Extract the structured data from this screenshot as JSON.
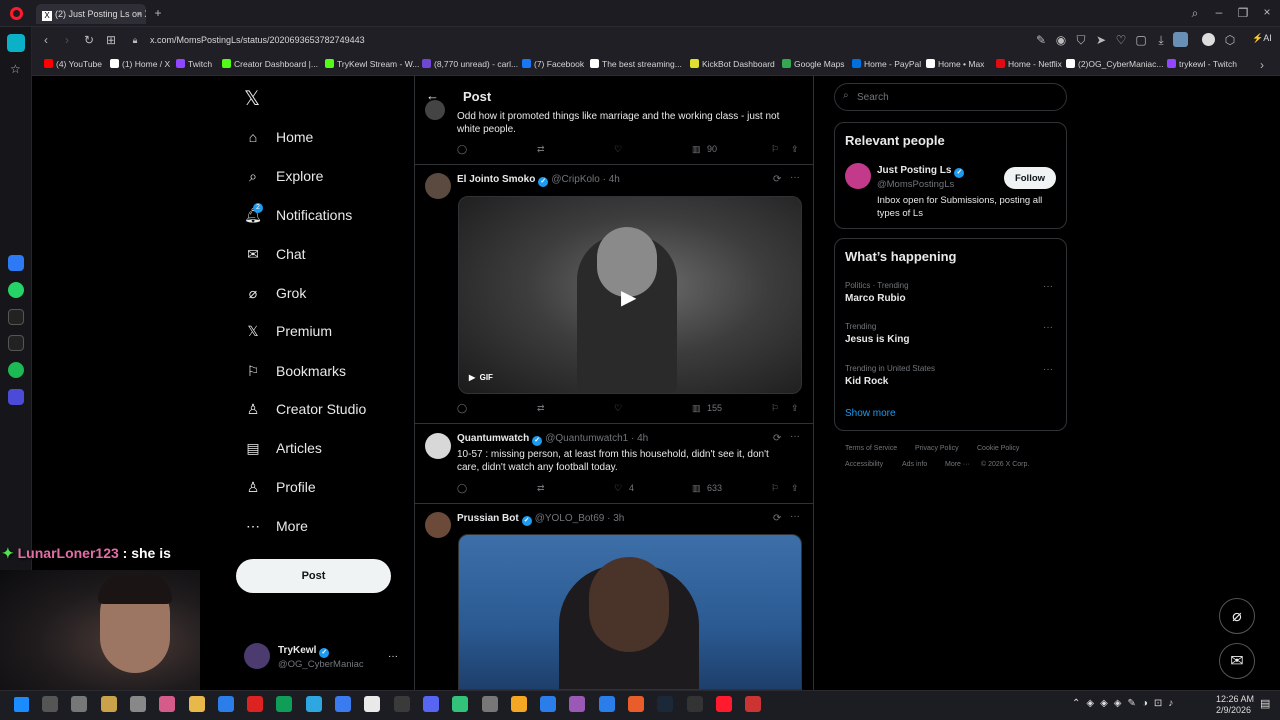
{
  "browser": {
    "tab_title": "(2) Just Posting Ls on X: \"",
    "url": "x.com/MomsPostingLs/status/2020693653782749443",
    "bookmarks": [
      {
        "label": "(4) YouTube",
        "color": "#ff0000"
      },
      {
        "label": "(1) Home / X",
        "color": "#ffffff"
      },
      {
        "label": "Twitch",
        "color": "#9146ff"
      },
      {
        "label": "Creator Dashboard |...",
        "color": "#53fc18"
      },
      {
        "label": "TryKewl Stream - W...",
        "color": "#53fc18"
      },
      {
        "label": "(8,770 unread) - carl...",
        "color": "#6e47d3"
      },
      {
        "label": "(7) Facebook",
        "color": "#1877f2"
      },
      {
        "label": "The best streaming...",
        "color": "#ffffff"
      },
      {
        "label": "KickBot Dashboard",
        "color": "#e0e030"
      },
      {
        "label": "Google Maps",
        "color": "#34a853"
      },
      {
        "label": "Home - PayPal",
        "color": "#0070e0"
      },
      {
        "label": "Home • Max",
        "color": "#ffffff"
      },
      {
        "label": "Home - Netflix",
        "color": "#e50914"
      },
      {
        "label": "(2)OG_CyberManiac...",
        "color": "#ffffff"
      },
      {
        "label": "trykewl - Twitch",
        "color": "#9146ff"
      }
    ]
  },
  "nav": {
    "logo": "𝕏",
    "items": [
      "Home",
      "Explore",
      "Notifications",
      "Chat",
      "Grok",
      "Premium",
      "Bookmarks",
      "Creator Studio",
      "Articles",
      "Profile",
      "More"
    ],
    "notification_badge": "2",
    "post_button": "Post"
  },
  "account": {
    "name": "TryKewl",
    "handle": "@OG_CyberManiac"
  },
  "header": {
    "title": "Post"
  },
  "tweets": [
    {
      "text": "Odd how it promoted things like marriage and the working class - just not white people.",
      "views": "90"
    },
    {
      "name": "El Jointo Smoko",
      "handle": "@CripKolo · 4h",
      "views": "155",
      "media_label": "GIF"
    },
    {
      "name": "Quantumwatch",
      "handle": "@Quantumwatch1 · 4h",
      "text": "10-57 : missing person, at least from this household, didn't see it, don't care, didn't watch any football today.",
      "likes": "4",
      "views": "633"
    },
    {
      "name": "Prussian Bot",
      "handle": "@YOLO_Bot69 · 3h"
    }
  ],
  "search": {
    "placeholder": "Search"
  },
  "relevant": {
    "title": "Relevant people",
    "name": "Just Posting Ls",
    "handle": "@MomsPostingLs",
    "bio": "Inbox open for Submissions, posting all types of Ls",
    "follow": "Follow"
  },
  "happening": {
    "title": "What’s happening",
    "trends": [
      {
        "meta": "Politics · Trending",
        "title": "Marco Rubio"
      },
      {
        "meta": "Trending",
        "title": "Jesus is King"
      },
      {
        "meta": "Trending in United States",
        "title": "Kid Rock"
      }
    ],
    "show_more": "Show more"
  },
  "footer": {
    "line1": [
      "Terms of Service",
      "Privacy Policy",
      "Cookie Policy"
    ],
    "line2": [
      "Accessibility",
      "Ads info",
      "More ···",
      "© 2026 X Corp."
    ]
  },
  "overlay": {
    "chat_user": "LunarLoner123",
    "chat_text": " : she is"
  },
  "taskbar": {
    "time": "12:26 AM",
    "date": "2/9/2026"
  }
}
